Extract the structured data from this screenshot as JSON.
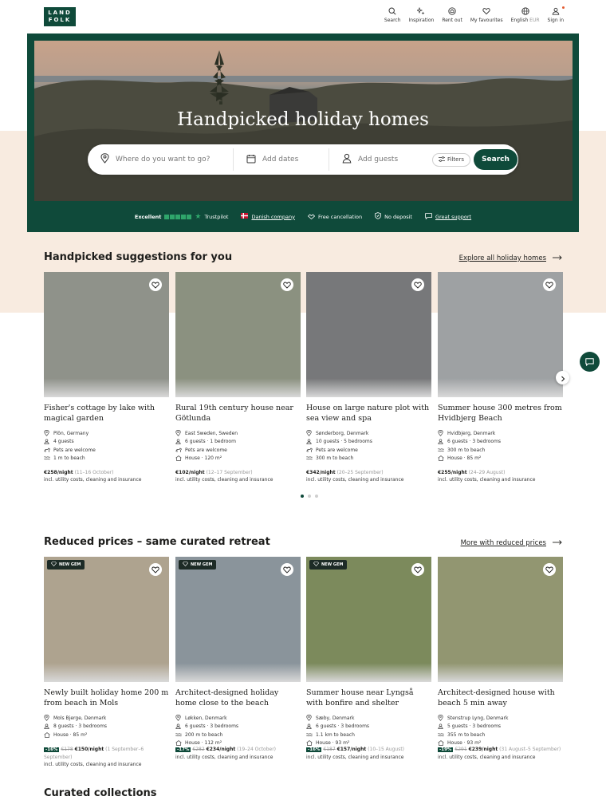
{
  "header": {
    "logo_line1": "LAND",
    "logo_line2": "FOLK",
    "nav": [
      {
        "label": "Search",
        "icon": "search-icon"
      },
      {
        "label": "Inspiration",
        "icon": "sparkle-icon"
      },
      {
        "label": "Rent out",
        "icon": "home-icon"
      },
      {
        "label": "My favourites",
        "icon": "heart-icon"
      },
      {
        "label": "English",
        "suffix": "EUR",
        "icon": "globe-icon"
      },
      {
        "label": "Sign in",
        "icon": "user-icon"
      }
    ]
  },
  "hero": {
    "title": "Handpicked holiday homes",
    "search": {
      "where_placeholder": "Where do you want to go?",
      "dates_placeholder": "Add dates",
      "guests_placeholder": "Add guests",
      "filters_label": "Filters",
      "button_label": "Search"
    },
    "trust": {
      "excellent": "Excellent",
      "trustpilot": "Trustpilot",
      "danish": "Danish company",
      "free_cancel": "Free cancellation",
      "no_deposit": "No deposit",
      "support": "Great support"
    }
  },
  "suggestions": {
    "title": "Handpicked suggestions for you",
    "link": "Explore all holiday homes",
    "cards": [
      {
        "title": "Fisher's cottage by lake with magical garden",
        "facts": [
          "Plön, Germany",
          "4 guests",
          "Pets are welcome",
          "1 m to beach"
        ],
        "price": "€258/night",
        "dates": "(11–16 October)",
        "incl": "incl. utility costs, cleaning and insurance",
        "color": "#8f928a"
      },
      {
        "title": "Rural 19th century house near Götlunda",
        "facts": [
          "East Sweden, Sweden",
          "6 guests · 1 bedroom",
          "Pets are welcome",
          "House · 120 m²"
        ],
        "price": "€102/night",
        "dates": "(12–17 September)",
        "incl": "incl. utility costs, cleaning and insurance",
        "color": "#8b9180"
      },
      {
        "title": "House on large nature plot with sea view and spa",
        "facts": [
          "Sønderborg, Denmark",
          "10 guests · 5 bedrooms",
          "Pets are welcome",
          "300 m to beach"
        ],
        "price": "€342/night",
        "dates": "(20–25 September)",
        "incl": "incl. utility costs, cleaning and insurance",
        "color": "#77787a"
      },
      {
        "title": "Summer house 300 metres from Hvidbjerg Beach",
        "facts": [
          "Hvidbjerg, Denmark",
          "6 guests · 3 bedrooms",
          "300 m to beach",
          "House · 85 m²"
        ],
        "price": "€255/night",
        "dates": "(24–29 August)",
        "incl": "incl. utility costs, cleaning and insurance",
        "color": "#9ea1a3"
      }
    ]
  },
  "reduced": {
    "title": "Reduced prices – same curated retreat",
    "link": "More with reduced prices",
    "badge": "NEW GEM",
    "cards": [
      {
        "title": "Newly built holiday home 200 m from beach in Mols",
        "facts": [
          "Mols Bjerge, Denmark",
          "8 guests · 3 bedrooms",
          "House · 85 m²"
        ],
        "discount": "-16%",
        "old": "€178",
        "price": "€150/night",
        "dates": "(1 September–6 September)",
        "incl": "incl. utility costs, cleaning and insurance",
        "color": "#aea38f",
        "badge": true
      },
      {
        "title": "Architect-designed holiday home close to the beach",
        "facts": [
          "Løkken, Denmark",
          "6 guests · 3 bedrooms",
          "200 m to beach",
          "House · 112 m²"
        ],
        "discount": "-17%",
        "old": "€282",
        "price": "€234/night",
        "dates": "(19–24 October)",
        "incl": "incl. utility costs, cleaning and insurance",
        "color": "#8a949b",
        "badge": true
      },
      {
        "title": "Summer house near Lyngså with bonfire and shelter",
        "facts": [
          "Sæby, Denmark",
          "6 guests · 3 bedrooms",
          "1.1 km to beach",
          "House · 93 m²"
        ],
        "discount": "-16%",
        "old": "€187",
        "price": "€157/night",
        "dates": "(10–15 August)",
        "incl": "incl. utility costs, cleaning and insurance",
        "color": "#7c8a5c",
        "badge": true
      },
      {
        "title": "Architect-designed house with beach 5 min away",
        "facts": [
          "Stenstrup Lyng, Denmark",
          "5 guests · 3 bedrooms",
          "355 m to beach",
          "House · 93 m²"
        ],
        "discount": "-19%",
        "old": "€291",
        "price": "€239/night",
        "dates": "(31 August–5 September)",
        "incl": "incl. utility costs, cleaning and insurance",
        "color": "#929671",
        "badge": false
      }
    ]
  },
  "curated": {
    "title": "Curated collections"
  },
  "colors": {
    "brand": "#0f4a3a",
    "peach": "#f8ebe0"
  }
}
